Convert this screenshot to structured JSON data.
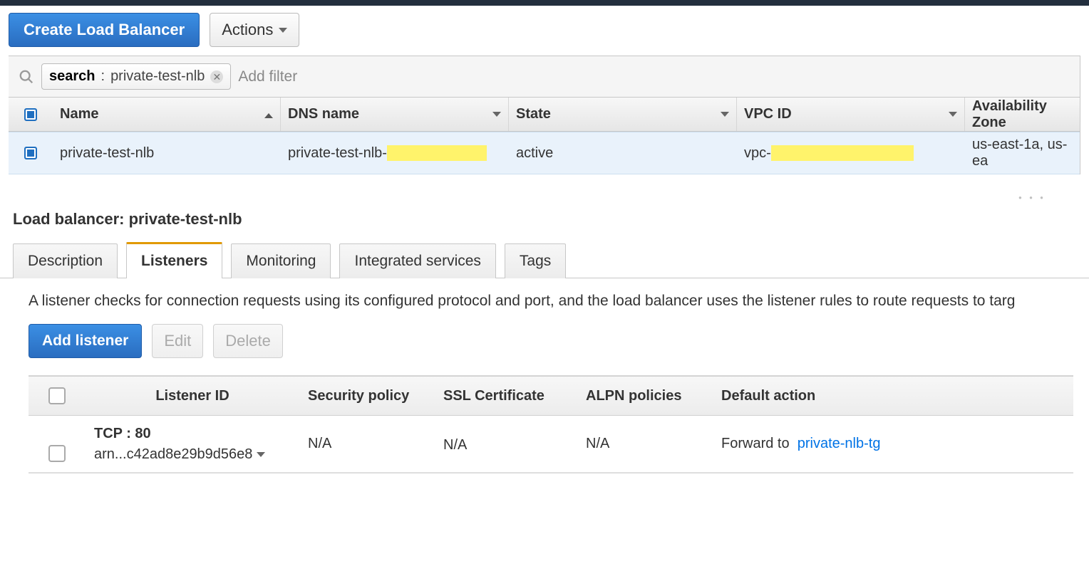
{
  "toolbar": {
    "create_label": "Create Load Balancer",
    "actions_label": "Actions"
  },
  "search": {
    "chip_key": "search",
    "chip_value": "private-test-nlb",
    "add_filter": "Add filter"
  },
  "table": {
    "columns": {
      "name": "Name",
      "dns": "DNS name",
      "state": "State",
      "vpc": "VPC ID",
      "az": "Availability Zone"
    },
    "row": {
      "name": "private-test-nlb",
      "dns_prefix": "private-test-nlb-",
      "state": "active",
      "vpc_prefix": "vpc-",
      "az": "us-east-1a, us-ea"
    }
  },
  "detail": {
    "title_prefix": "Load balancer:",
    "title_name": "private-test-nlb"
  },
  "tabs": {
    "description": "Description",
    "listeners": "Listeners",
    "monitoring": "Monitoring",
    "integrated": "Integrated services",
    "tags": "Tags"
  },
  "listeners": {
    "description": "A listener checks for connection requests using its configured protocol and port, and the load balancer uses the listener rules to route requests to targ",
    "add_label": "Add listener",
    "edit_label": "Edit",
    "delete_label": "Delete",
    "columns": {
      "id": "Listener ID",
      "security": "Security policy",
      "ssl": "SSL Certificate",
      "alpn": "ALPN policies",
      "default": "Default action"
    },
    "row": {
      "protocol": "TCP : 80",
      "arn": "arn...c42ad8e29b9d56e8",
      "security": "N/A",
      "ssl": "N/A",
      "alpn": "N/A",
      "action_prefix": "Forward to",
      "action_target": "private-nlb-tg"
    }
  }
}
